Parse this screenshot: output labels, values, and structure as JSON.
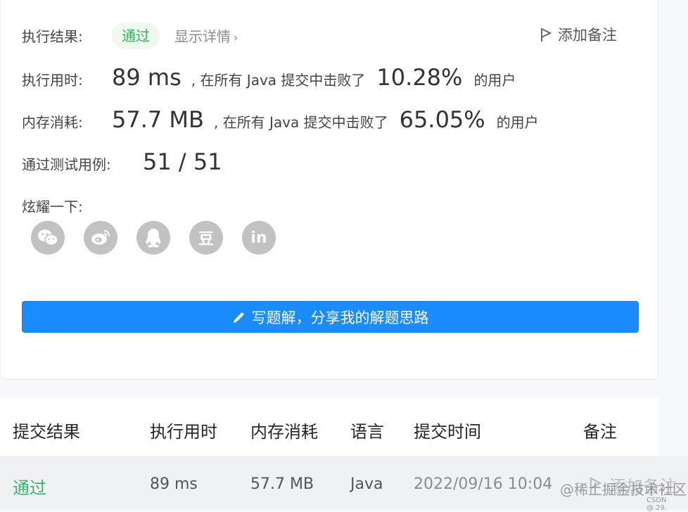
{
  "result": {
    "label": "执行结果:",
    "status": "通过",
    "details_link": "显示详情",
    "add_note": "添加备注"
  },
  "runtime": {
    "label": "执行用时:",
    "value": "89 ms",
    "middle": ", 在所有 Java 提交中击败了",
    "percent": "10.28%",
    "suffix": "的用户"
  },
  "memory": {
    "label": "内存消耗:",
    "value": "57.7 MB",
    "middle": ", 在所有 Java 提交中击败了",
    "percent": "65.05%",
    "suffix": "的用户"
  },
  "tests": {
    "label": "通过测试用例:",
    "value": "51 / 51"
  },
  "share": {
    "label": "炫耀一下:",
    "items": [
      {
        "icon": "wechat-icon"
      },
      {
        "icon": "weibo-icon"
      },
      {
        "icon": "qq-icon"
      },
      {
        "icon": "douban-icon",
        "glyph": "豆"
      },
      {
        "icon": "linkedin-icon",
        "glyph": "in"
      }
    ]
  },
  "write_solution": "写题解，分享我的解题思路",
  "table": {
    "headers": [
      "提交结果",
      "执行用时",
      "内存消耗",
      "语言",
      "提交时间",
      "备注"
    ],
    "row": {
      "result": "通过",
      "runtime": "89 ms",
      "memory": "57.7 MB",
      "language": "Java",
      "time": "2022/09/16 10:04",
      "note": "添加备注"
    }
  },
  "watermark": {
    "main": "@稀土掘金技术社区",
    "small": "CSDN @.29."
  },
  "colors": {
    "accent": "#1a8cff",
    "pass": "#2db55d",
    "icon_gray": "#c2c2c2"
  }
}
